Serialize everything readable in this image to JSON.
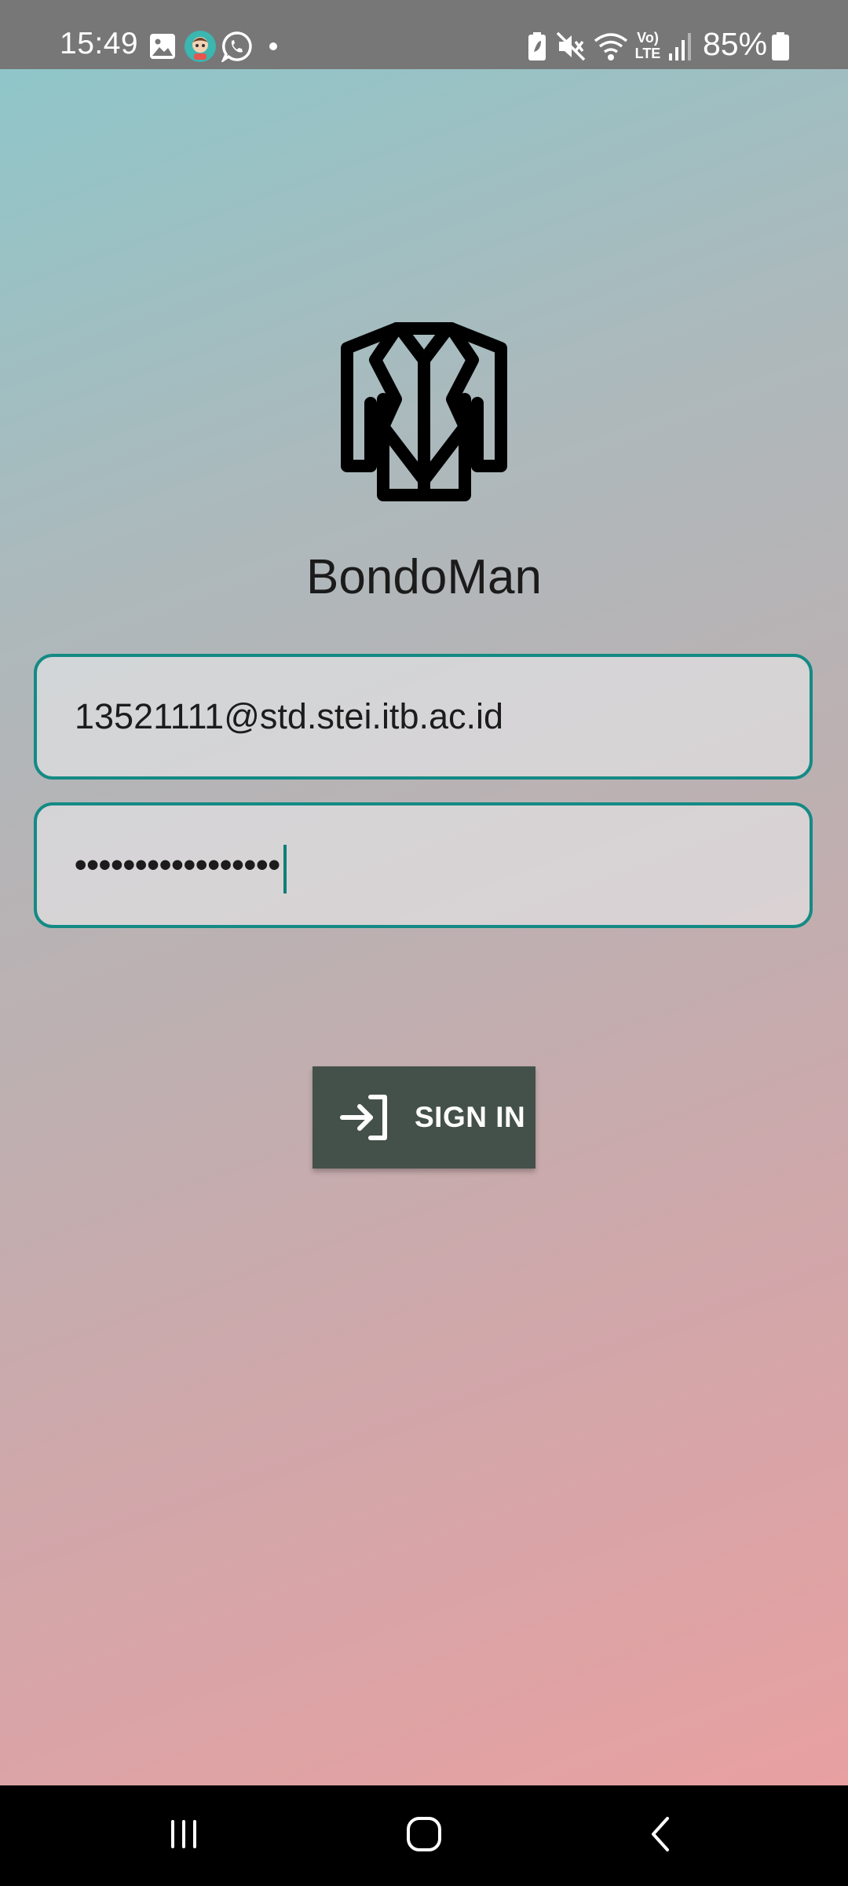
{
  "status_bar": {
    "time": "15:49",
    "battery_percent": "85%",
    "icons": [
      "gallery-icon",
      "app-notification-icon",
      "whatsapp-icon",
      "dot-icon",
      "battery-saver-icon",
      "mute-icon",
      "wifi-icon",
      "volte-icon",
      "signal-icon",
      "battery-icon"
    ],
    "volte_line1": "Vo)",
    "volte_line2": "LTE"
  },
  "app": {
    "logo_icon": "jacket-icon",
    "title": "BondoMan"
  },
  "login_form": {
    "email_value": "13521111@std.stei.itb.ac.id",
    "password_value": "•••••••••••••••••",
    "accent_color": "#148a85"
  },
  "sign_in_button": {
    "label": "SIGN IN",
    "icon": "login-icon",
    "color": "#44514a"
  },
  "nav_bar": {
    "items": [
      "recent-apps-icon",
      "home-icon",
      "back-icon"
    ]
  }
}
